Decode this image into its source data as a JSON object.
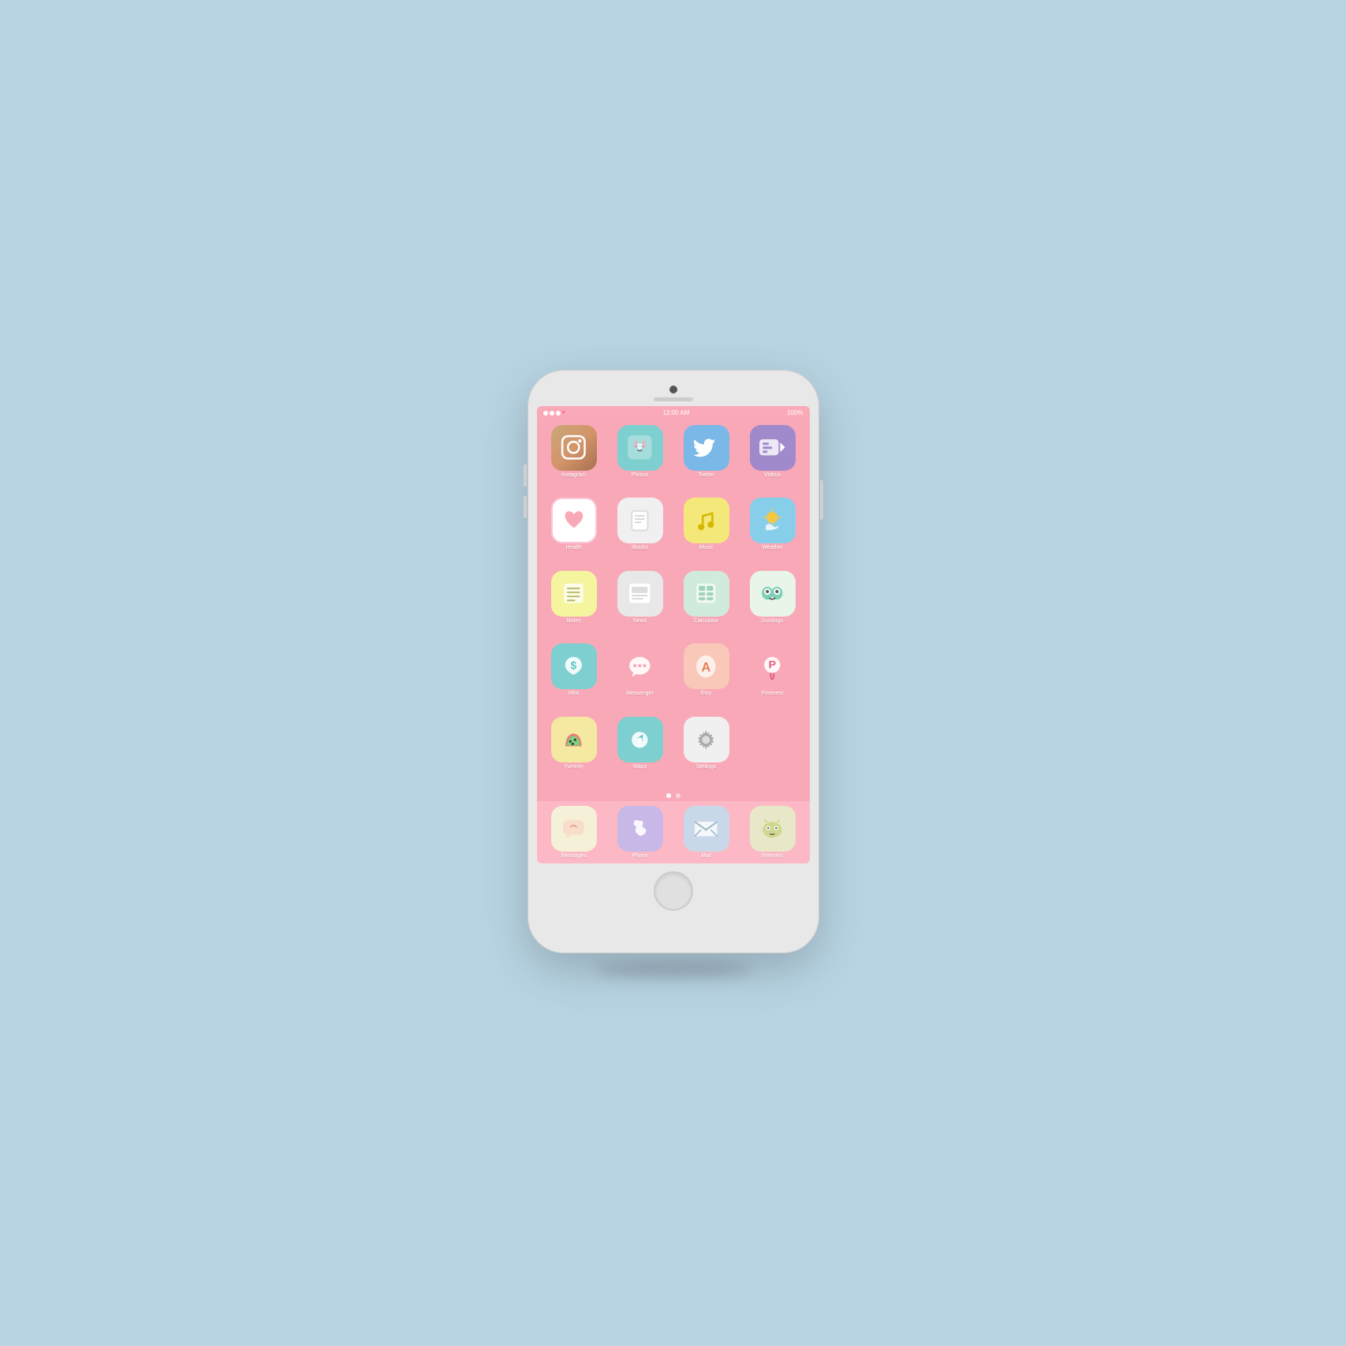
{
  "background": "#b8d4e3",
  "status_bar": {
    "time": "12:00 AM",
    "battery": "100%"
  },
  "apps": [
    {
      "name": "Instagram",
      "bg": "ig-bg",
      "icon": "instagram"
    },
    {
      "name": "Photos",
      "bg": "photos-bg",
      "icon": "photos"
    },
    {
      "name": "Twitter",
      "bg": "twitter-bg",
      "icon": "twitter"
    },
    {
      "name": "Videos",
      "bg": "videos-bg",
      "icon": "videos"
    },
    {
      "name": "Health",
      "bg": "health-bg",
      "icon": "health"
    },
    {
      "name": "iBooks",
      "bg": "ibooks-bg",
      "icon": "ibooks"
    },
    {
      "name": "Music",
      "bg": "music-bg",
      "icon": "music"
    },
    {
      "name": "Weather",
      "bg": "weather-bg",
      "icon": "weather"
    },
    {
      "name": "Notes",
      "bg": "notes-bg",
      "icon": "notes"
    },
    {
      "name": "News",
      "bg": "news-bg",
      "icon": "news"
    },
    {
      "name": "Calculator",
      "bg": "calculator-bg",
      "icon": "calculator"
    },
    {
      "name": "Duolingo",
      "bg": "duolingo-bg",
      "icon": "duolingo"
    },
    {
      "name": "Mint",
      "bg": "mint-bg",
      "icon": "mint"
    },
    {
      "name": "Messenger",
      "bg": "messenger-bg",
      "icon": "messenger"
    },
    {
      "name": "Etsy",
      "bg": "etsy-bg",
      "icon": "etsy"
    },
    {
      "name": "Pinterest",
      "bg": "pinterest-bg",
      "icon": "pinterest"
    },
    {
      "name": "Yummly",
      "bg": "yummly-bg",
      "icon": "yummly"
    },
    {
      "name": "Maps",
      "bg": "maps-bg",
      "icon": "maps"
    },
    {
      "name": "Settings",
      "bg": "settings-bg",
      "icon": "settings"
    }
  ],
  "dock": [
    {
      "name": "Messages",
      "bg": "messages-dock-bg",
      "icon": "messages"
    },
    {
      "name": "Phone",
      "bg": "phone-dock-bg",
      "icon": "phone"
    },
    {
      "name": "Mail",
      "bg": "mail-dock-bg",
      "icon": "mail"
    },
    {
      "name": "Internets",
      "bg": "internet-dock-bg",
      "icon": "internet"
    }
  ]
}
